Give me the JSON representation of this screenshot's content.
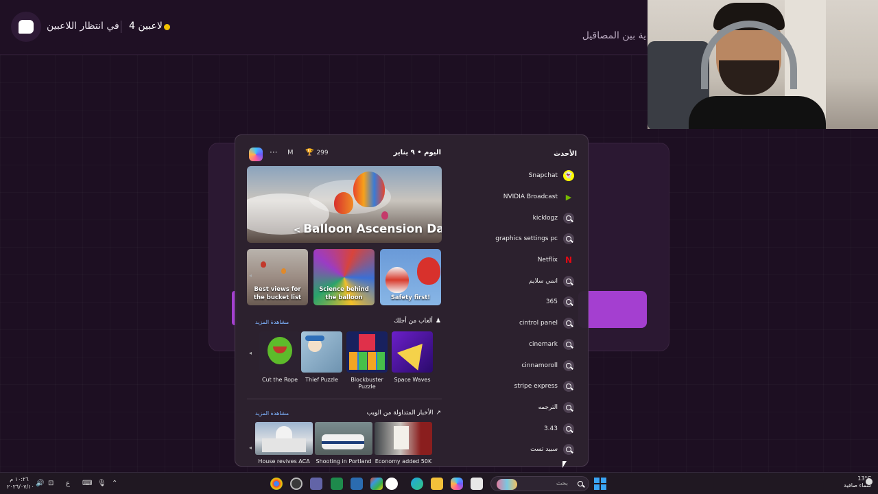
{
  "top_bar": {
    "waiting_label": "في انتظار اللاعبين",
    "players_count": "4 لاعبين",
    "page_title": "ية بين المصاقيل"
  },
  "start_menu": {
    "account_initial": "M",
    "rewards_points": "299",
    "date": "اليوم • ٩ يناير",
    "recent_title": "الأحدث",
    "recent_items": [
      {
        "label": "Snapchat",
        "icon": "snapchat-icon"
      },
      {
        "label": "NVIDIA Broadcast",
        "icon": "nvidia-icon"
      },
      {
        "label": "kicklogz",
        "icon": "search-icon"
      },
      {
        "label": "graphics settings pc",
        "icon": "search-icon"
      },
      {
        "label": "Netflix",
        "icon": "netflix-icon"
      },
      {
        "label": "انمي سلايم",
        "icon": "search-icon"
      },
      {
        "label": "365",
        "icon": "search-icon"
      },
      {
        "label": "cintrol panel",
        "icon": "search-icon"
      },
      {
        "label": "cinemark",
        "icon": "search-icon"
      },
      {
        "label": "cinnamoroll",
        "icon": "search-icon"
      },
      {
        "label": "stripe express",
        "icon": "search-icon"
      },
      {
        "label": "الترجمه",
        "icon": "search-icon"
      },
      {
        "label": "3.43",
        "icon": "search-icon"
      },
      {
        "label": "سبيد تست",
        "icon": "search-icon"
      }
    ],
    "hero_title": "Balloon Ascension Day",
    "stories": [
      {
        "label": "Best views for the bucket list"
      },
      {
        "label": "Science behind the balloon"
      },
      {
        "label": "Safety first!"
      }
    ],
    "games_section_title": "ألعاب من أجلك",
    "games_see_more": "مشاهدة المزيد",
    "games": [
      {
        "label": "Cut the Rope"
      },
      {
        "label": "Thief Puzzle"
      },
      {
        "label": "Blockbuster Puzzle"
      },
      {
        "label": "Space Waves"
      }
    ],
    "news_section_title": "الأخبار المتداولة من الويب",
    "news_see_more": "مشاهدة المزيد",
    "news": [
      {
        "label": "House revives ACA"
      },
      {
        "label": "Shooting in Portland"
      },
      {
        "label": "Economy added 50K"
      }
    ]
  },
  "taskbar": {
    "search_placeholder": "بحث",
    "weather_temp": "13°C",
    "weather_desc": "سماء صافية",
    "time": "١٠:٢٦ م",
    "date": "٢٠٢٦/٠٧/١٠",
    "language": "ع"
  },
  "colors": {
    "accent_purple": "#a43fd0",
    "status_dot": "#f2c200",
    "link_blue": "#7fb4ff"
  }
}
